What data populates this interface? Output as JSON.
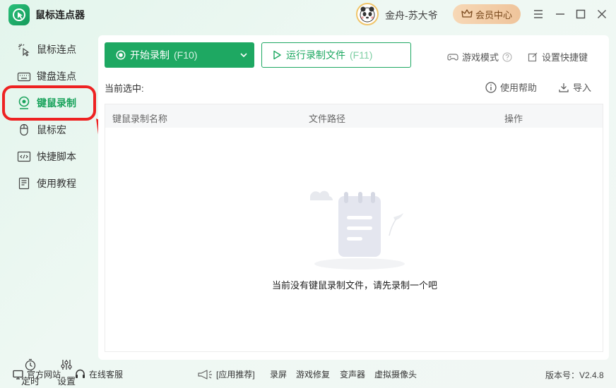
{
  "app": {
    "title": "鼠标连点器"
  },
  "user": {
    "name": "金舟-苏大爷"
  },
  "vip": {
    "label": "会员中心"
  },
  "sidebar": {
    "items": [
      {
        "label": "鼠标连点",
        "icon": "click-icon"
      },
      {
        "label": "键盘连点",
        "icon": "keyboard-icon"
      },
      {
        "label": "键鼠录制",
        "icon": "record-icon",
        "active": true
      },
      {
        "label": "鼠标宏",
        "icon": "mouse-icon"
      },
      {
        "label": "快捷脚本",
        "icon": "code-icon"
      },
      {
        "label": "使用教程",
        "icon": "book-icon"
      }
    ],
    "timer_label": "定时",
    "settings_label": "设置"
  },
  "toolbar": {
    "start_label": "开始录制",
    "start_hotkey": "(F10)",
    "run_label": "运行录制文件",
    "run_hotkey": "(F11)",
    "game_mode": "游戏模式",
    "set_hotkey": "设置快捷键",
    "help": "使用帮助",
    "import": "导入"
  },
  "current_selection": "当前选中:",
  "table": {
    "columns": [
      "键鼠录制名称",
      "文件路径",
      "操作"
    ],
    "empty_text": "当前没有键鼠录制文件，请先录制一个吧"
  },
  "footer": {
    "website": "官方网站",
    "support": "在线客服",
    "recommend": "[应用推荐]",
    "links": [
      "录屏",
      "游戏修复",
      "变声器",
      "虚拟摄像头"
    ],
    "version": "版本号：V2.4.8"
  },
  "colors": {
    "accent": "#1ea862",
    "highlight": "#ee2222"
  }
}
